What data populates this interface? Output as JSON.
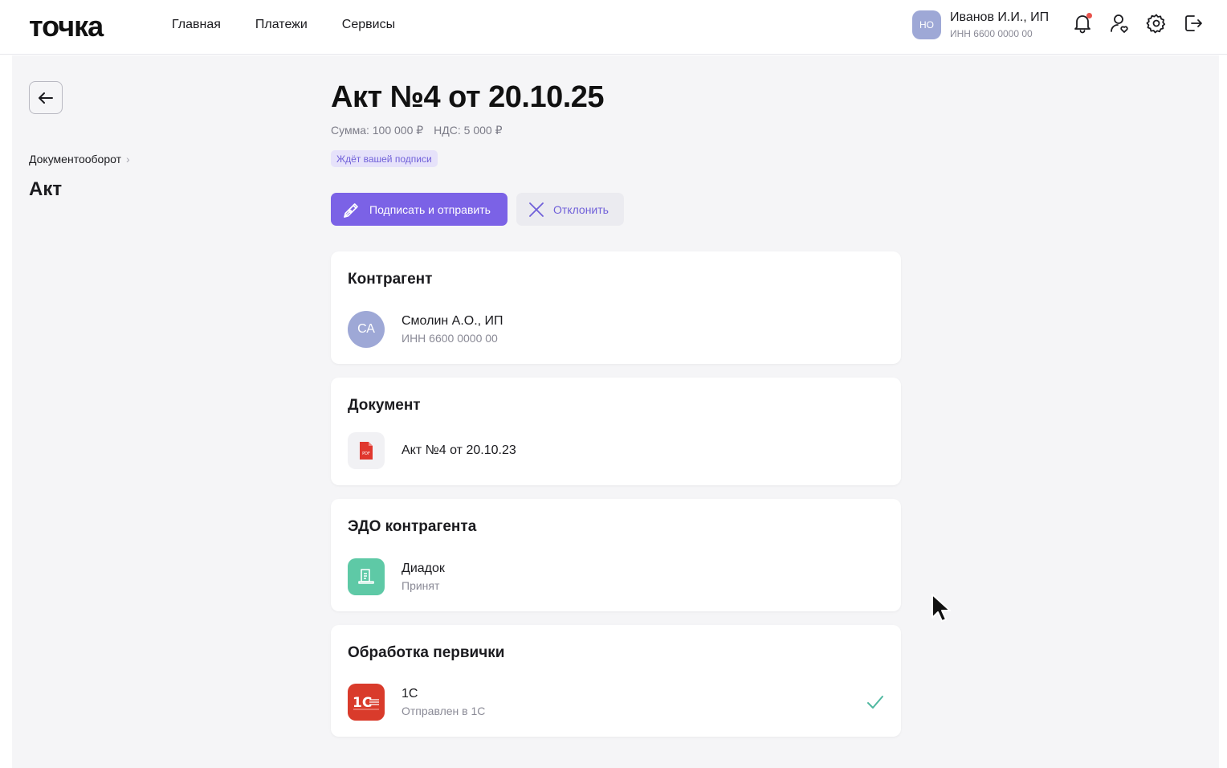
{
  "header": {
    "logo": "точка",
    "nav": [
      "Главная",
      "Платежи",
      "Сервисы"
    ],
    "user": {
      "initials": "НО",
      "name": "Иванов И.И., ИП",
      "inn": "ИНН 6600 0000 00"
    },
    "icons": [
      "bell-icon",
      "user-heart-icon",
      "gear-icon",
      "logout-icon"
    ]
  },
  "sidebar": {
    "breadcrumb": "Документооборот",
    "title": "Акт"
  },
  "document": {
    "title": "Акт №4 от 20.10.25",
    "sum": "Сумма: 100 000 ₽",
    "vat": "НДС: 5 000 ₽",
    "status": "Ждёт вашей подписи",
    "sign_label": "Подписать и отправить",
    "reject_label": "Отклонить"
  },
  "cards": {
    "counterparty": {
      "title": "Контрагент",
      "initials": "СА",
      "name": "Смолин А.О., ИП",
      "inn": "ИНН 6600 0000 00"
    },
    "file": {
      "title": "Документ",
      "name": "Акт №4 от 20.10.23",
      "icon_label": "PDF"
    },
    "edo": {
      "title": "ЭДО контрагента",
      "name": "Диадок",
      "status": "Принят"
    },
    "primary": {
      "title": "Обработка первички",
      "name": "1С",
      "status": "Отправлен в 1С",
      "logo_text": "1С"
    }
  },
  "colors": {
    "accent": "#7b62e6",
    "badge_bg": "#e6e2fa",
    "diadoc": "#5ec9a6",
    "onec": "#d93b2b",
    "check": "#4fb8a0",
    "notification": "#e8524c"
  }
}
